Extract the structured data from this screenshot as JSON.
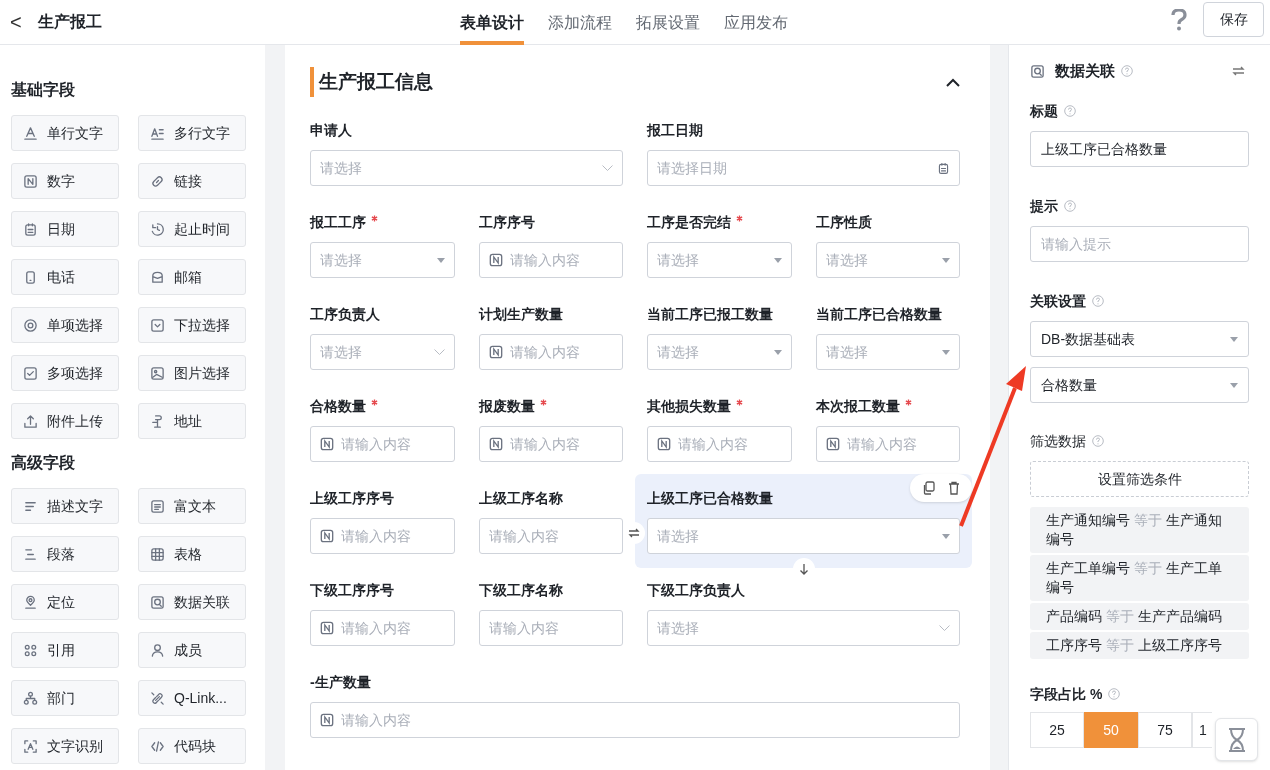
{
  "header": {
    "back": "<",
    "title": "生产报工",
    "tabs": [
      {
        "label": "表单设计",
        "selected": true
      },
      {
        "label": "添加流程",
        "selected": false
      },
      {
        "label": "拓展设置",
        "selected": false
      },
      {
        "label": "应用发布",
        "selected": false
      }
    ],
    "save": "保存"
  },
  "palette": [
    {
      "title": "基础字段",
      "items": [
        "单行文字",
        "多行文字",
        "数字",
        "链接",
        "日期",
        "起止时间",
        "电话",
        "邮箱",
        "单项选择",
        "下拉选择",
        "多项选择",
        "图片选择",
        "附件上传",
        "地址"
      ]
    },
    {
      "title": "高级字段",
      "items": [
        "描述文字",
        "富文本",
        "段落",
        "表格",
        "定位",
        "数据关联",
        "引用",
        "成员",
        "部门",
        "Q-Link...",
        "文字识别",
        "代码块"
      ]
    }
  ],
  "form": {
    "title": "生产报工信息",
    "expanded": true,
    "fields": [
      {
        "label": "申请人",
        "required": false,
        "kind": "select",
        "placeholder": "请选择",
        "selected": false
      },
      {
        "label": "报工日期",
        "required": false,
        "kind": "date",
        "placeholder": "请选择日期",
        "selected": false
      },
      {
        "label": "报工工序",
        "required": true,
        "kind": "dropdown",
        "placeholder": "请选择",
        "selected": false
      },
      {
        "label": "工序序号",
        "required": false,
        "kind": "number",
        "placeholder": "请输入内容",
        "selected": false
      },
      {
        "label": "工序是否完结",
        "required": true,
        "kind": "dropdown",
        "placeholder": "请选择",
        "selected": false
      },
      {
        "label": "工序性质",
        "required": false,
        "kind": "dropdown",
        "placeholder": "请选择",
        "selected": false
      },
      {
        "label": "工序负责人",
        "required": false,
        "kind": "select",
        "placeholder": "请选择",
        "selected": false
      },
      {
        "label": "计划生产数量",
        "required": false,
        "kind": "number",
        "placeholder": "请输入内容",
        "selected": false
      },
      {
        "label": "当前工序已报工数量",
        "required": false,
        "kind": "dropdown",
        "placeholder": "请选择",
        "selected": false
      },
      {
        "label": "当前工序已合格数量",
        "required": false,
        "kind": "dropdown",
        "placeholder": "请选择",
        "selected": false
      },
      {
        "label": "合格数量",
        "required": true,
        "kind": "number",
        "placeholder": "请输入内容",
        "selected": false
      },
      {
        "label": "报废数量",
        "required": true,
        "kind": "number",
        "placeholder": "请输入内容",
        "selected": false
      },
      {
        "label": "其他损失数量",
        "required": true,
        "kind": "number",
        "placeholder": "请输入内容",
        "selected": false
      },
      {
        "label": "本次报工数量",
        "required": true,
        "kind": "number",
        "placeholder": "请输入内容",
        "selected": false
      },
      {
        "label": "上级工序序号",
        "required": false,
        "kind": "number",
        "placeholder": "请输入内容",
        "selected": false
      },
      {
        "label": "上级工序名称",
        "required": false,
        "kind": "text",
        "placeholder": "请输入内容",
        "selected": false
      },
      {
        "label": "上级工序已合格数量",
        "required": false,
        "kind": "dropdown",
        "placeholder": "请选择",
        "selected": true
      },
      {
        "label": "下级工序序号",
        "required": false,
        "kind": "number",
        "placeholder": "请输入内容",
        "selected": false
      },
      {
        "label": "下级工序名称",
        "required": false,
        "kind": "text",
        "placeholder": "请输入内容",
        "selected": false
      },
      {
        "label": "下级工序负责人",
        "required": false,
        "kind": "select",
        "placeholder": "请选择",
        "selected": false
      },
      {
        "label": "-生产数量",
        "required": false,
        "kind": "number",
        "placeholder": "请输入内容",
        "selected": false
      }
    ]
  },
  "properties": {
    "title": "数据关联",
    "label_title": "标题",
    "title_value": "上级工序已合格数量",
    "label_hint": "提示",
    "hint_placeholder": "请输入提示",
    "label_link": "关联设置",
    "link_table": "DB-数据基础表",
    "link_field": "合格数量",
    "label_filter": "筛选数据",
    "filter_button": "设置筛选条件",
    "conditions": [
      {
        "field": "生产通知编号",
        "op": "等于",
        "value": "生产通知编号"
      },
      {
        "field": "生产工单编号",
        "op": "等于",
        "value": "生产工单编号"
      },
      {
        "field": "产品编码",
        "op": "等于",
        "value": "生产产品编码"
      },
      {
        "field": "工序序号",
        "op": "等于",
        "value": "上级工序序号"
      }
    ],
    "label_width": "字段占比 %",
    "widths": [
      {
        "label": "25",
        "selected": false
      },
      {
        "label": "50",
        "selected": true
      },
      {
        "label": "75",
        "selected": false
      },
      {
        "label": "1",
        "selected": false
      }
    ]
  }
}
